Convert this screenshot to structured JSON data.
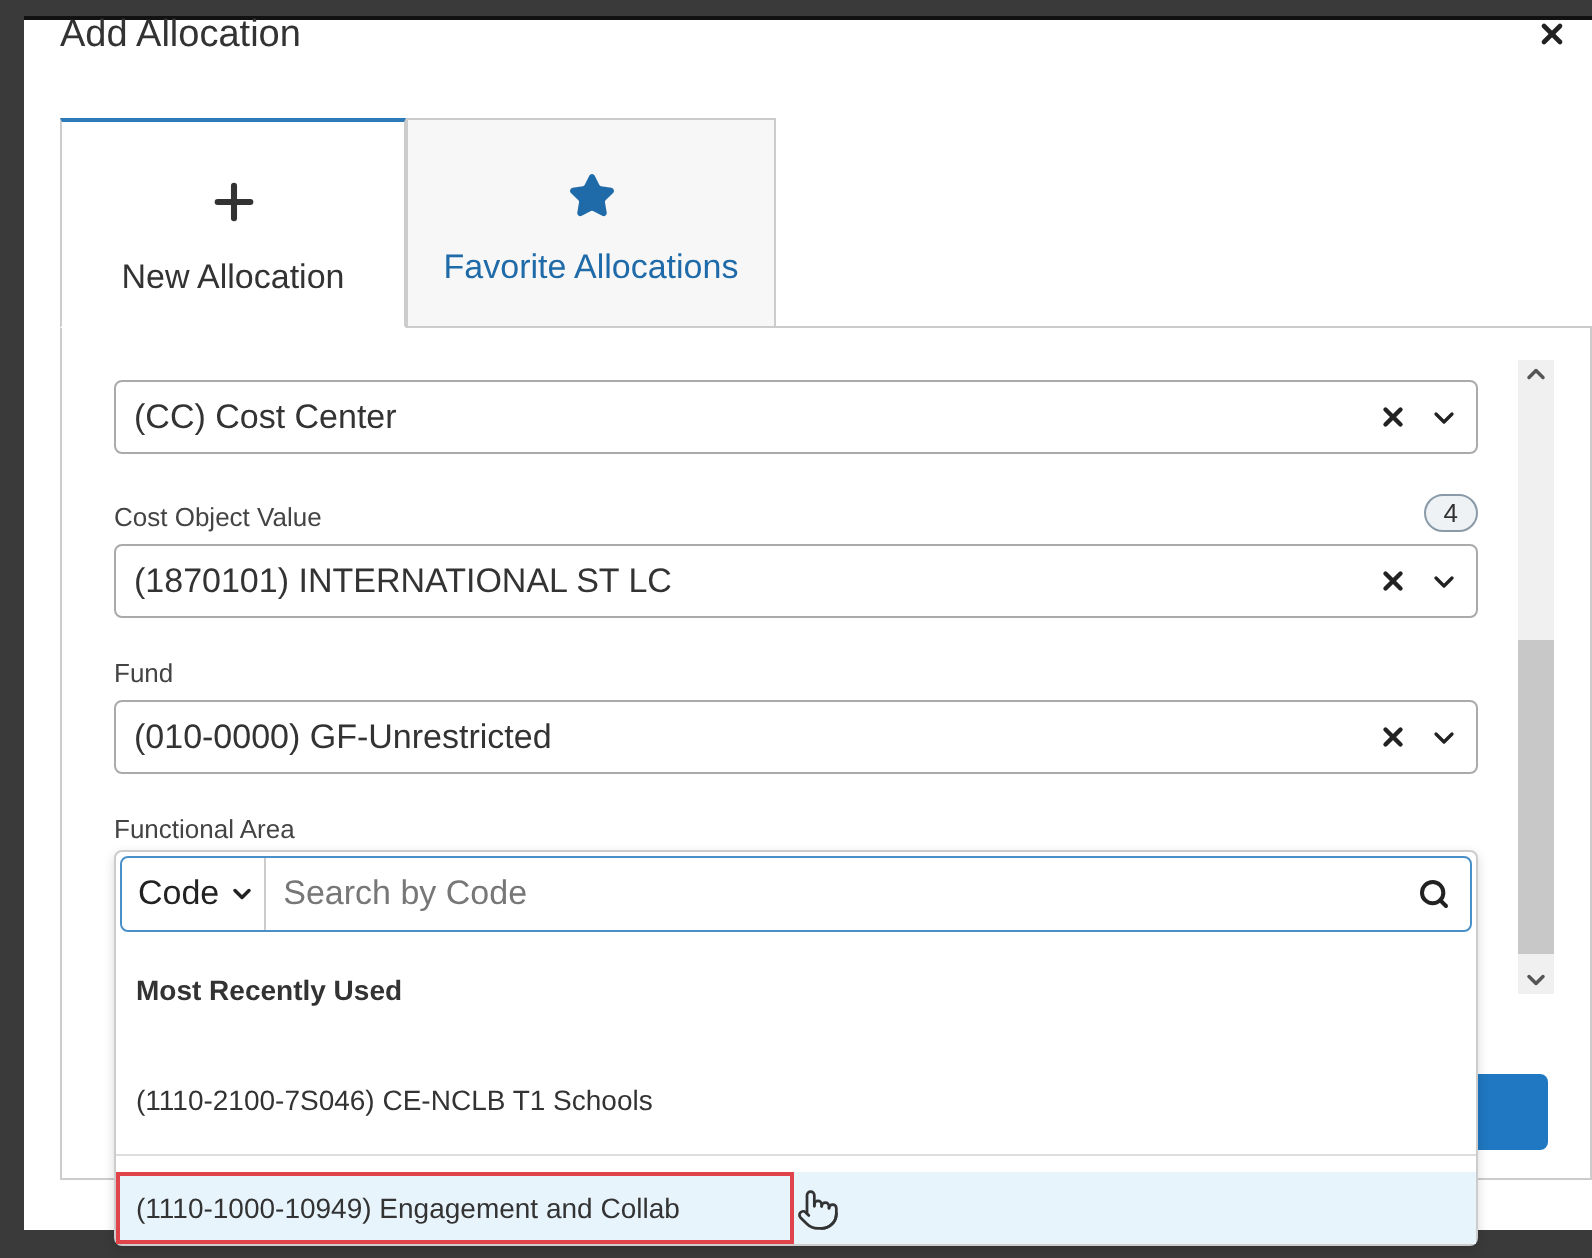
{
  "dialog": {
    "title": "Add Allocation"
  },
  "tabs": [
    {
      "label": "New Allocation",
      "kind": "plus",
      "selected": true
    },
    {
      "label": "Favorite Allocations",
      "kind": "star",
      "selected": false
    }
  ],
  "fields": [
    {
      "value": "(CC) Cost Center"
    },
    {
      "label": "Cost Object Value",
      "badge": "4",
      "value": "(1870101) INTERNATIONAL ST LC"
    },
    {
      "label": "Fund",
      "value": "(010-0000) GF-Unrestricted"
    }
  ],
  "functional_area": {
    "label": "Functional Area",
    "search": {
      "mode": "Code",
      "placeholder": "Search by Code"
    },
    "section": "Most Recently Used",
    "options": [
      {
        "text": "(1110-2100-7S046) CE-NCLB T1 Schools",
        "selected": false
      },
      {
        "text": "(1110-1000-10949) Engagement and Collab",
        "selected": true
      }
    ]
  }
}
